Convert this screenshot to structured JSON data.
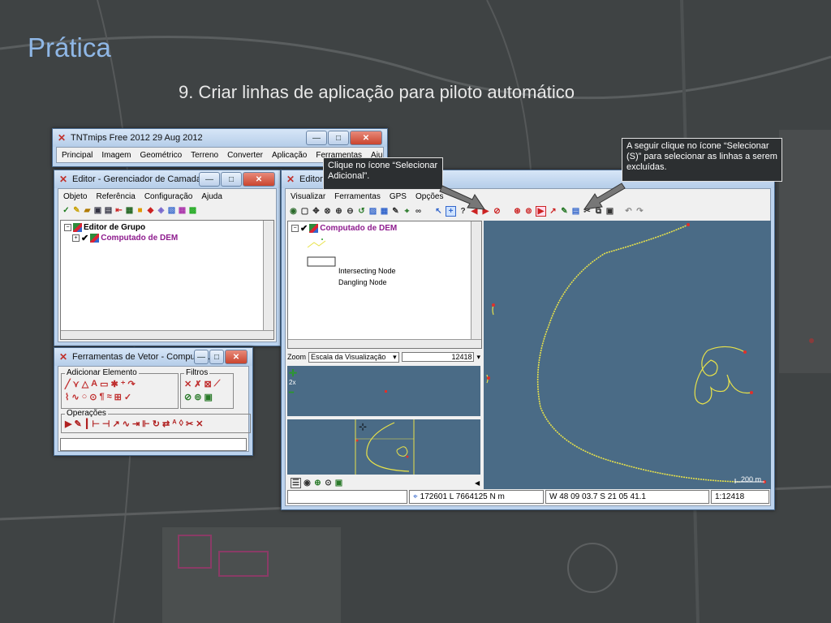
{
  "slide": {
    "title": "Prática",
    "subtitle": "9. Criar linhas de aplicação para piloto automático"
  },
  "main_window": {
    "title": "TNTmips Free 2012   29 Aug 2012",
    "menu": [
      "Principal",
      "Imagem",
      "Geométrico",
      "Terreno",
      "Converter",
      "Aplicação",
      "Ferramentas",
      "Ajuda"
    ]
  },
  "layer_manager": {
    "title": "Editor - Gerenciador de Camadas",
    "menu": [
      "Objeto",
      "Referência",
      "Configuração",
      "Ajuda"
    ],
    "tree": [
      {
        "label": "Editor de Grupo"
      },
      {
        "label": "Computado de DEM"
      }
    ]
  },
  "vector_tools": {
    "title": "Ferramentas de Vetor - Computa...",
    "group_add": "Adicionar Elemento",
    "group_filters": "Filtros",
    "group_ops": "Operações"
  },
  "editor": {
    "title": "Editor",
    "menu": [
      "Visualizar",
      "Ferramentas",
      "GPS",
      "Opções"
    ],
    "layer": "Computado de DEM",
    "legend": [
      "Intersecting Node",
      "Dangling Node"
    ],
    "zoom_label": "Zoom",
    "zoom_mode": "Escala da Visualização",
    "zoom_value": "12418",
    "zoom_factor": "2x",
    "scale_bar": "200 m",
    "status": {
      "coords": "172601 L  7664125 N m",
      "latlon": "W 48 09 03.7  S 21 05 41.1",
      "scale": "1:12418"
    }
  },
  "callouts": {
    "left": "Clique no ícone “Selecionar Adicional”.",
    "right": "A seguir clique no ícone “Selecionar (S)” para selecionar as linhas a serem excluídas."
  },
  "colors": {
    "title_blue": "#8fb7e6",
    "map_water": "#4a6b86",
    "line_yellow": "#e8e24a",
    "node_red": "#e0302a"
  }
}
